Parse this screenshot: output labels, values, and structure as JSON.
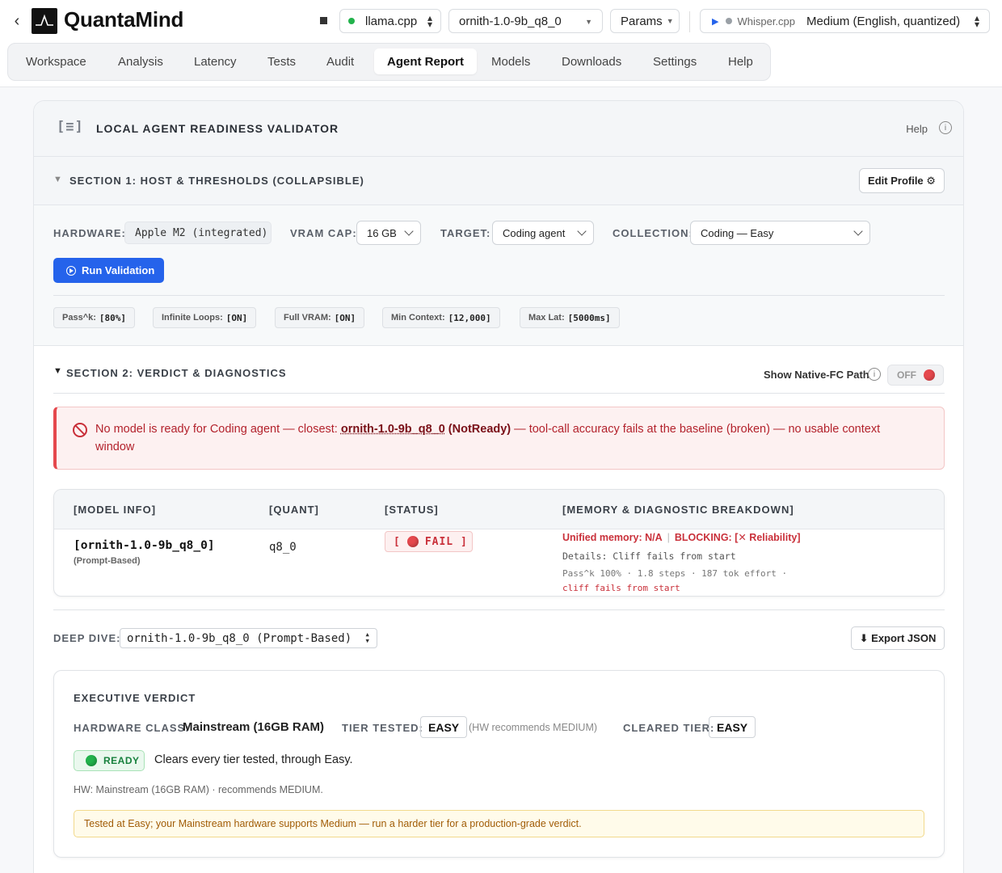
{
  "app": {
    "brand": "QuantaMind",
    "back_glyph": "‹",
    "engine": "llama.cpp",
    "model": "ornith-1.0-9b_q8_0",
    "params": "Params",
    "whisper_label": "Whisper.cpp",
    "whisper_model": "Medium (English, quantized)"
  },
  "tabs": [
    {
      "label": "Workspace"
    },
    {
      "label": "Analysis"
    },
    {
      "label": "Latency"
    },
    {
      "label": "Tests"
    },
    {
      "label": "Audit"
    },
    {
      "label": "Agent Report",
      "active": true
    },
    {
      "label": "Models"
    },
    {
      "label": "Downloads"
    },
    {
      "label": "Settings"
    },
    {
      "label": "Help"
    }
  ],
  "validator": {
    "icon_text": "[≡]",
    "title": "LOCAL AGENT READINESS VALIDATOR",
    "help": "Help",
    "help_icon": "i"
  },
  "section1": {
    "title": "SECTION 1: HOST & THRESHOLDS (COLLAPSIBLE)",
    "edit_profile": "Edit Profile ⚙",
    "hardware_label": "HARDWARE:",
    "hardware_value": "Apple M2 (integrated)",
    "vram_label": "VRAM CAP:",
    "vram_value": "16 GB",
    "target_label": "TARGET:",
    "target_value": "Coding agent",
    "collection_label": "COLLECTION:",
    "collection_value": "Coding — Easy",
    "run_label": "Run Validation",
    "thresholds": [
      {
        "label": "Pass^k:",
        "value": "[80%]"
      },
      {
        "label": "Infinite Loops:",
        "value": "[ON]"
      },
      {
        "label": "Full VRAM:",
        "value": "[ON]"
      },
      {
        "label": "Min Context:",
        "value": "[12,000]"
      },
      {
        "label": "Max Lat:",
        "value": "[5000ms]"
      }
    ]
  },
  "section2": {
    "title": "SECTION 2: VERDICT & DIAGNOSTICS",
    "native_fc_label": "Show Native-FC Path",
    "toggle_state": "OFF",
    "alert": {
      "prefix": "No model is ready for Coding agent — closest: ",
      "closest": "ornith-1.0-9b_q8_0",
      "status": " (NotReady)",
      "suffix": " — tool-call accuracy fails at the baseline (broken) — no usable context window"
    },
    "table": {
      "headers": [
        "[MODEL INFO]",
        "[QUANT]",
        "[STATUS]",
        "[MEMORY & DIAGNOSTIC BREAKDOWN]"
      ],
      "row": {
        "name": "[ornith-1.0-9b_q8_0]",
        "sub": "(Prompt-Based)",
        "quant": "q8_0",
        "status_open": "[",
        "status_text": "FAIL ]",
        "memory": "Unified memory: N/A",
        "memory_sep": "|",
        "blocking": "BLOCKING: [✕ Reliability]",
        "details": "Details: Cliff fails from start",
        "stats": "Pass^k 100%  ·  1.8 steps  ·  187 tok effort  ·",
        "cliff": "cliff fails from start"
      }
    },
    "deep_dive_label": "DEEP DIVE:",
    "deep_dive_value": "ornith-1.0-9b_q8_0 (Prompt-Based)",
    "export_label": "⬇ Export JSON"
  },
  "executive": {
    "title": "EXECUTIVE VERDICT",
    "hw_class_label": "HARDWARE CLASS:",
    "hw_class_value": "Mainstream (16GB RAM)",
    "tier_tested_label": "TIER TESTED:",
    "tier_tested_value": "EASY",
    "hw_recommends": "(HW recommends MEDIUM)",
    "cleared_label": "CLEARED TIER:",
    "cleared_value": "EASY",
    "badge": "READY",
    "ready_text": "Clears every tier tested, through Easy.",
    "hw_note": "HW: Mainstream (16GB RAM) · recommends MEDIUM.",
    "warning": "Tested at Easy; your Mainstream hardware supports Medium — run a harder tier for a production-grade verdict."
  },
  "colors": {
    "accent": "#2563eb",
    "fail": "#e5484d",
    "ready": "#22b24c",
    "warning": "#a15c07"
  }
}
